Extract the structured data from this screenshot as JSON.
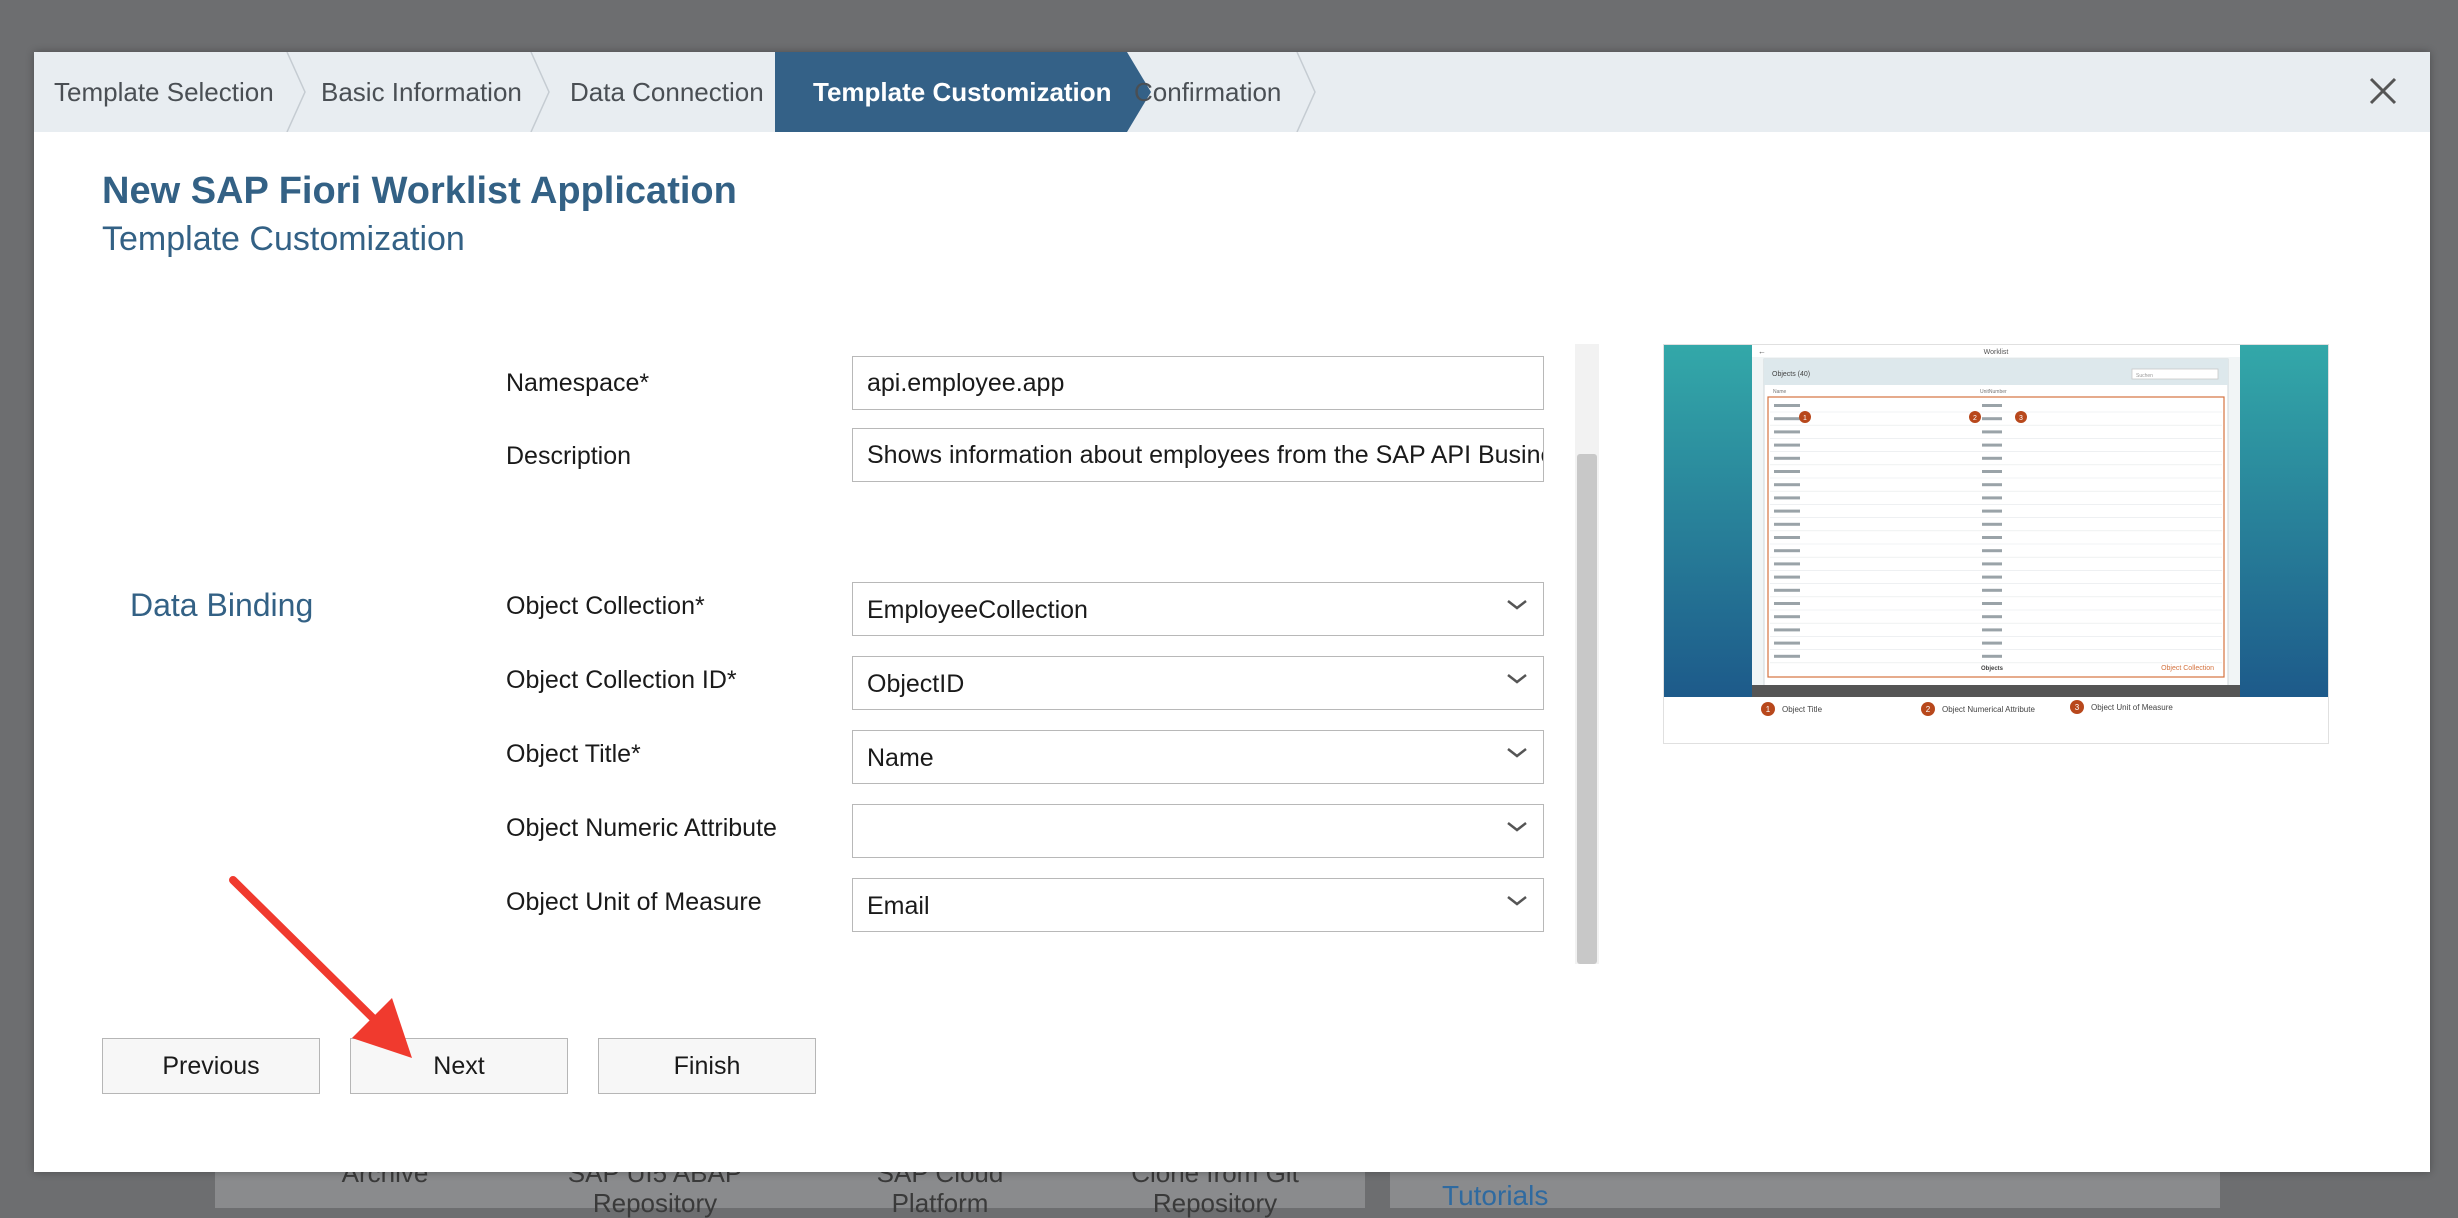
{
  "background": {
    "items": [
      "Archive",
      "SAP UI5 ABAP Repository",
      "SAP Cloud Platform",
      "Clone from Git Repository"
    ],
    "tutorials_link": "Tutorials"
  },
  "wizard": {
    "steps": [
      {
        "label": "Template Selection",
        "active": false
      },
      {
        "label": "Basic Information",
        "active": false
      },
      {
        "label": "Data Connection",
        "active": false
      },
      {
        "label": "Template Customization",
        "active": true
      },
      {
        "label": "Confirmation",
        "active": false
      }
    ]
  },
  "header": {
    "title": "New SAP Fiori Worklist Application",
    "subtitle": "Template Customization"
  },
  "section": {
    "data_binding_label": "Data Binding"
  },
  "fields": {
    "namespace": {
      "label": "Namespace*",
      "value": "api.employee.app"
    },
    "description": {
      "label": "Description",
      "value": "Shows information about employees from the SAP API Business Hub"
    },
    "object_collection": {
      "label": "Object Collection*",
      "value": "EmployeeCollection"
    },
    "object_collection_id": {
      "label": "Object Collection ID*",
      "value": "ObjectID"
    },
    "object_title": {
      "label": "Object Title*",
      "value": "Name"
    },
    "object_numeric_attribute": {
      "label": "Object Numeric Attribute",
      "value": ""
    },
    "object_unit_of_measure": {
      "label": "Object Unit of Measure",
      "value": "Email"
    }
  },
  "preview": {
    "app_bar_title": "Worklist",
    "list_title": "Objects (40)",
    "search_placeholder": "Suchen",
    "col_name": "Name",
    "col_unit": "UnitNumber",
    "footer_label": "Objects",
    "collection_label": "Object Collection",
    "legend": [
      {
        "num": "1",
        "label": "Object Title"
      },
      {
        "num": "2",
        "label": "Object Numerical Attribute"
      },
      {
        "num": "3",
        "label": "Object Unit of Measure"
      }
    ]
  },
  "buttons": {
    "previous": "Previous",
    "next": "Next",
    "finish": "Finish"
  },
  "colors": {
    "accent": "#346187",
    "annotation_arrow": "#f03a2e",
    "badge": "#b8481c"
  }
}
